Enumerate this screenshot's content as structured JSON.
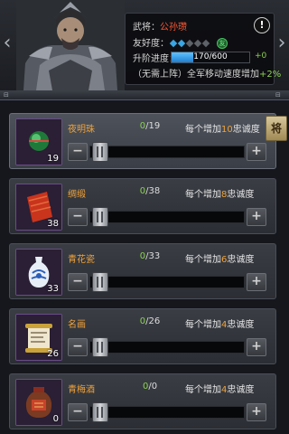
{
  "header": {
    "general_label": "武将：",
    "general_name": "公孙瓒",
    "friendship_label": "友好度：",
    "friendship_level": 2,
    "friendship_max": 5,
    "progress_label": "升阶进度：",
    "progress_text": "170/600",
    "progress_value": 170,
    "progress_max": 600,
    "progress_bonus": "+0",
    "note_text": "（无需上阵）全军移动速度增加",
    "note_value": "+2%",
    "warn_glyph": "!",
    "friend_glyph": "友",
    "nav_left": "‹",
    "nav_right": "›"
  },
  "divider": {
    "left_glyph": "⊟",
    "right_glyph": "⊟"
  },
  "side_tab": "将",
  "items": [
    {
      "name": "夜明珠",
      "qty": "19",
      "count_cur": "0",
      "count_max": "19",
      "effect_prefix": "每个增加",
      "effect_value": "10",
      "effect_suffix": "忠诚度",
      "icon": "pearl-icon",
      "selected": true
    },
    {
      "name": "绸缎",
      "qty": "38",
      "count_cur": "0",
      "count_max": "38",
      "effect_prefix": "每个增加",
      "effect_value": "8",
      "effect_suffix": "忠诚度",
      "icon": "silk-icon",
      "selected": false
    },
    {
      "name": "青花瓷",
      "qty": "33",
      "count_cur": "0",
      "count_max": "33",
      "effect_prefix": "每个增加",
      "effect_value": "6",
      "effect_suffix": "忠诚度",
      "icon": "porcelain-icon",
      "selected": false
    },
    {
      "name": "名画",
      "qty": "26",
      "count_cur": "0",
      "count_max": "26",
      "effect_prefix": "每个增加",
      "effect_value": "4",
      "effect_suffix": "忠诚度",
      "icon": "scroll-painting-icon",
      "selected": false
    },
    {
      "name": "青梅酒",
      "qty": "0",
      "count_cur": "0",
      "count_max": "0",
      "effect_prefix": "每个增加",
      "effect_value": "4",
      "effect_suffix": "忠诚度",
      "icon": "wine-jar-icon",
      "selected": false
    }
  ],
  "buttons": {
    "minus": "−",
    "plus": "+"
  },
  "colors": {
    "accent_orange": "#f0a23a",
    "name_red": "#ff5a36",
    "value_green": "#8bd24f",
    "progress_blue": "#39a7e6"
  }
}
